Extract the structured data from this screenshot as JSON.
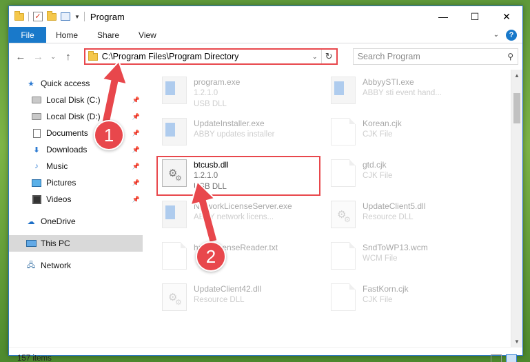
{
  "window": {
    "title": "Program",
    "controls": {
      "minimize": "—",
      "maximize": "☐",
      "close": "✕"
    }
  },
  "ribbon": {
    "file": "File",
    "tabs": [
      "Home",
      "Share",
      "View"
    ]
  },
  "address": {
    "path": "C:\\Program Files\\Program Directory"
  },
  "search": {
    "placeholder": "Search Program"
  },
  "sidebar": {
    "quick_access": "Quick access",
    "items": [
      {
        "label": "Local Disk (C:)",
        "icon": "drive-icon"
      },
      {
        "label": "Local Disk (D:)",
        "icon": "drive-icon"
      },
      {
        "label": "Documents",
        "icon": "documents-icon"
      },
      {
        "label": "Downloads",
        "icon": "downloads-icon"
      },
      {
        "label": "Music",
        "icon": "music-icon"
      },
      {
        "label": "Pictures",
        "icon": "pictures-icon"
      },
      {
        "label": "Videos",
        "icon": "videos-icon"
      }
    ],
    "onedrive": "OneDrive",
    "this_pc": "This PC",
    "network": "Network"
  },
  "files": [
    {
      "name": "program.exe",
      "line2": "1.2.1.0",
      "line3": "USB DLL",
      "icon": "exe"
    },
    {
      "name": "AbbyySTI.exe",
      "line2": "ABBY sti event hand...",
      "line3": "",
      "icon": "exe"
    },
    {
      "name": "UpdateInstaller.exe",
      "line2": "ABBY updates installer",
      "line3": "",
      "icon": "exe"
    },
    {
      "name": "Korean.cjk",
      "line2": "CJK File",
      "line3": "",
      "icon": "page"
    },
    {
      "name": "btcusb.dll",
      "line2": "1.2.1.0",
      "line3": "USB DLL",
      "icon": "dll"
    },
    {
      "name": "gtd.cjk",
      "line2": "CJK File",
      "line3": "",
      "icon": "page"
    },
    {
      "name": "NetworkLicenseServer.exe",
      "line2": "ABBY network licens...",
      "line3": "",
      "icon": "exe"
    },
    {
      "name": "UpdateClient5.dll",
      "line2": "Resource DLL",
      "line3": "",
      "icon": "dll"
    },
    {
      "name": "haspLicenseReader.txt",
      "line2": "",
      "line3": "",
      "icon": "page"
    },
    {
      "name": "SndToWP13.wcm",
      "line2": "WCM File",
      "line3": "",
      "icon": "page"
    },
    {
      "name": "UpdateClient42.dll",
      "line2": "Resource DLL",
      "line3": "",
      "icon": "dll"
    },
    {
      "name": "FastKorn.cjk",
      "line2": "CJK File",
      "line3": "",
      "icon": "page"
    }
  ],
  "status": {
    "item_count": "157 items"
  },
  "callouts": {
    "one": "1",
    "two": "2"
  },
  "colors": {
    "accent": "#1979ca",
    "callout": "#e8474c"
  }
}
